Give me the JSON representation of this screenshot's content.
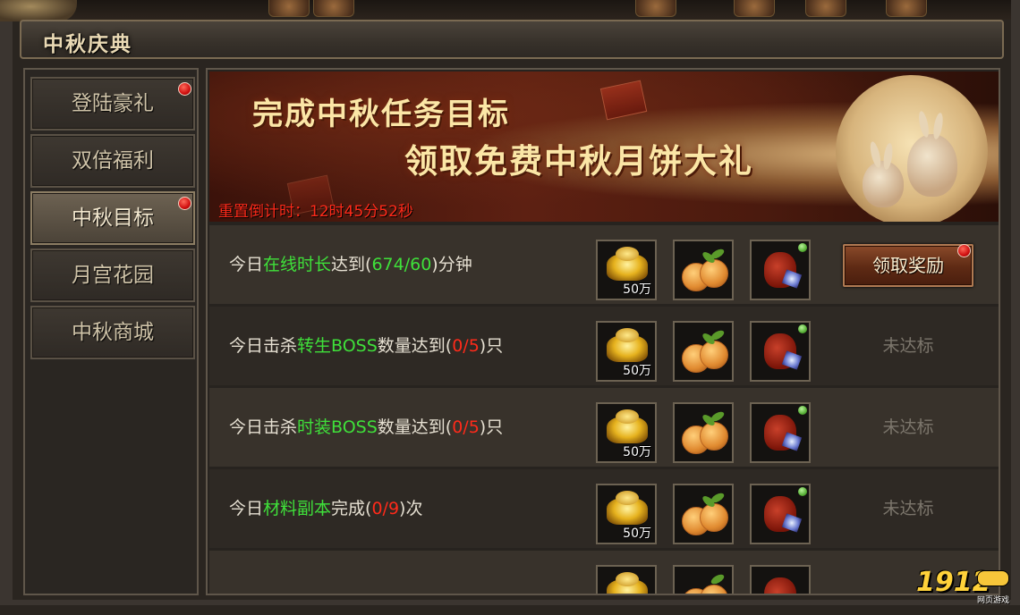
{
  "window": {
    "title": "中秋庆典"
  },
  "sidebar": {
    "items": [
      {
        "label": "登陆豪礼",
        "active": false,
        "badge": true
      },
      {
        "label": "双倍福利",
        "active": false,
        "badge": false
      },
      {
        "label": "中秋目标",
        "active": true,
        "badge": true
      },
      {
        "label": "月宫花园",
        "active": false,
        "badge": false
      },
      {
        "label": "中秋商城",
        "active": false,
        "badge": false
      }
    ]
  },
  "banner": {
    "line1": "完成中秋任务目标",
    "line2": "领取免费中秋月饼大礼",
    "countdown": "重置倒计时：12时45分52秒"
  },
  "tasks": [
    {
      "prefix": "今日",
      "highlight": "在线时长",
      "middle": "达到(",
      "progress": "674/60",
      "suffix": ")分钟",
      "progress_color": "green",
      "rewards": [
        {
          "icon": "gold-ingot-icon",
          "qty": "50万"
        },
        {
          "icon": "mooncake-icon",
          "qty": ""
        },
        {
          "icon": "treasure-bag-icon",
          "qty": ""
        }
      ],
      "action_label": "领取奖励",
      "claimable": true
    },
    {
      "prefix": "今日击杀",
      "highlight": "转生BOSS",
      "middle": "数量达到(",
      "progress": "0/5",
      "suffix": ")只",
      "progress_color": "red",
      "rewards": [
        {
          "icon": "gold-ingot-icon",
          "qty": "50万"
        },
        {
          "icon": "mooncake-icon",
          "qty": ""
        },
        {
          "icon": "treasure-bag-icon",
          "qty": ""
        }
      ],
      "action_label": "未达标",
      "claimable": false
    },
    {
      "prefix": "今日击杀",
      "highlight": "时装BOSS",
      "middle": "数量达到(",
      "progress": "0/5",
      "suffix": ")只",
      "progress_color": "red",
      "rewards": [
        {
          "icon": "gold-ingot-icon",
          "qty": "50万"
        },
        {
          "icon": "mooncake-icon",
          "qty": ""
        },
        {
          "icon": "treasure-bag-icon",
          "qty": ""
        }
      ],
      "action_label": "未达标",
      "claimable": false
    },
    {
      "prefix": "今日",
      "highlight": "材料副本",
      "middle": "完成(",
      "progress": "0/9",
      "suffix": ")次",
      "progress_color": "red",
      "rewards": [
        {
          "icon": "gold-ingot-icon",
          "qty": "50万"
        },
        {
          "icon": "mooncake-icon",
          "qty": ""
        },
        {
          "icon": "treasure-bag-icon",
          "qty": ""
        }
      ],
      "action_label": "未达标",
      "claimable": false
    }
  ],
  "watermark": {
    "text": "1912",
    "sub": "网页游戏"
  },
  "colors": {
    "highlight_green": "#3fe03a",
    "progress_red": "#ff2a1a",
    "countdown_red": "#ff2a1a",
    "title_gold": "#e9d9b4"
  }
}
